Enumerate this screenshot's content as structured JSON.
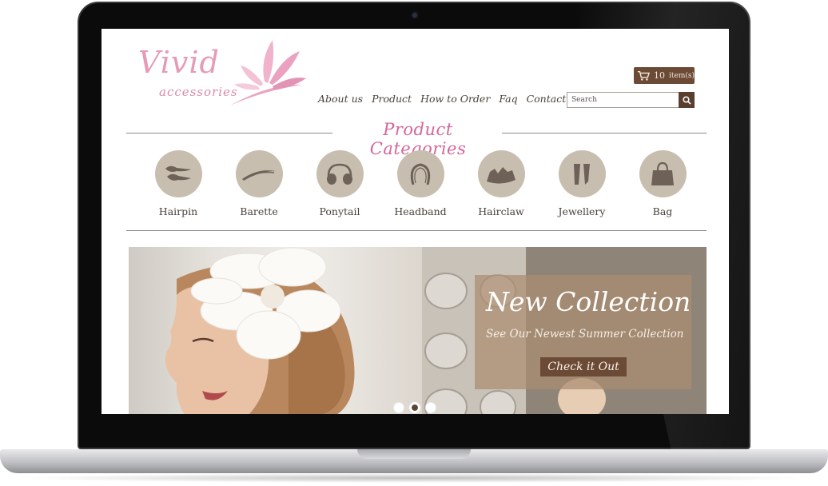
{
  "logo": {
    "name": "Vivid",
    "tagline": "accessories"
  },
  "cart": {
    "count": "10",
    "unit": "item(s)",
    "icon": "cart-icon"
  },
  "nav": {
    "items": [
      {
        "label": "About us"
      },
      {
        "label": "Product"
      },
      {
        "label": "How to Order"
      },
      {
        "label": "Faq"
      },
      {
        "label": "Contact Us"
      }
    ]
  },
  "search": {
    "placeholder": "Search",
    "icon": "search-icon"
  },
  "categories": {
    "title": "Product Categories",
    "items": [
      {
        "label": "Hairpin",
        "icon": "hairpin-icon"
      },
      {
        "label": "Barette",
        "icon": "barette-icon"
      },
      {
        "label": "Ponytail",
        "icon": "ponytail-icon"
      },
      {
        "label": "Headband",
        "icon": "headband-icon"
      },
      {
        "label": "Hairclaw",
        "icon": "hairclaw-icon"
      },
      {
        "label": "Jewellery",
        "icon": "jewellery-icon"
      },
      {
        "label": "Bag",
        "icon": "bag-icon"
      }
    ]
  },
  "banner": {
    "title": "New Collection",
    "subtitle": "See Our Newest Summer Collection",
    "cta": "Check it Out",
    "slides": 3,
    "active_slide": 2
  },
  "colors": {
    "brand_pink": "#d5669a",
    "brown": "#6b4a36",
    "circle": "#c8beaf",
    "icon": "#6e6258"
  }
}
